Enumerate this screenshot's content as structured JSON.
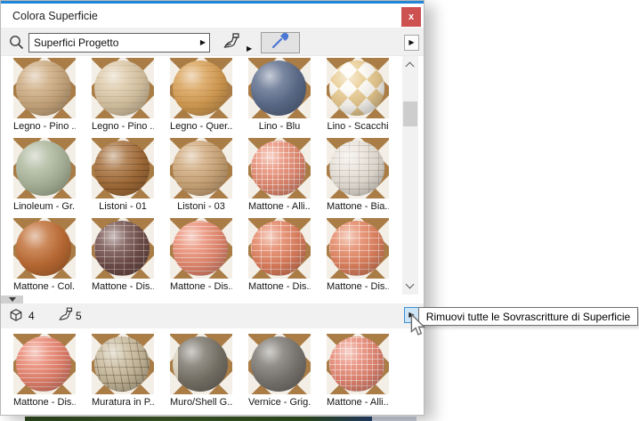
{
  "window": {
    "title": "Colora Superficie",
    "close_glyph": "x"
  },
  "toolbar": {
    "search_value": "Superfici Progetto",
    "dropdown_glyph": "▶",
    "brush_menu_glyph": "▶",
    "panel_arrow_glyph": "▶"
  },
  "status_bar": {
    "surface_count": "4",
    "override_count": "5",
    "menu_glyph": "▶"
  },
  "tooltip": {
    "text": "Rimuovi tutte le Sovrascritture di Superficie"
  },
  "colors": {
    "accent_blue": "#1f86d8",
    "close_red": "#cd5151",
    "checker_brown": "#aa7c46",
    "checker_cream": "#f3efe7",
    "hover_blue_bg": "#cde5f7",
    "hover_blue_border": "#3c8fd4"
  },
  "upper_grid": {
    "items": [
      {
        "label": "Legno - Pino ...",
        "base": "#cdab80",
        "pattern": "planks",
        "line": "rgba(140,100,60,0.22)"
      },
      {
        "label": "Legno - Pino ...",
        "base": "#dcc8a6",
        "pattern": "planks",
        "line": "rgba(150,115,70,0.20)"
      },
      {
        "label": "Legno - Quer...",
        "base": "#d9a055",
        "pattern": "planks",
        "line": "rgba(150,95,30,0.22)"
      },
      {
        "label": "Lino - Blu",
        "base": "#5d6d8c",
        "pattern": "none",
        "line": ""
      },
      {
        "label": "Lino - Scacchi",
        "base": "#e9cb90",
        "pattern": "checker",
        "line": "rgba(255,255,255,0.9)"
      },
      {
        "label": "Linoleum - Gr...",
        "base": "#aeb89d",
        "pattern": "none",
        "line": ""
      },
      {
        "label": "Listoni - 01",
        "base": "#a76f3a",
        "pattern": "planks",
        "line": "rgba(60,35,10,0.35)"
      },
      {
        "label": "Listoni - 03",
        "base": "#d0a97b",
        "pattern": "planks",
        "line": "rgba(120,80,40,0.28)"
      },
      {
        "label": "Mattone - Alli...",
        "base": "#e78a70",
        "pattern": "grid",
        "line": "rgba(255,255,255,0.5)"
      },
      {
        "label": "Mattone - Bia...",
        "base": "#eae4da",
        "pattern": "brick",
        "line": "rgba(180,170,160,0.6)"
      },
      {
        "label": "Mattone - Col...",
        "base": "#c06d34",
        "pattern": "none",
        "line": ""
      },
      {
        "label": "Mattone - Dis...",
        "base": "#6f4d4a",
        "pattern": "brick",
        "line": "rgba(220,200,190,0.5)"
      },
      {
        "label": "Mattone - Dis...",
        "base": "#e98a70",
        "pattern": "lines",
        "line": "rgba(255,255,255,0.45)"
      },
      {
        "label": "Mattone - Dis...",
        "base": "#e2805f",
        "pattern": "brick",
        "line": "rgba(255,240,230,0.55)"
      },
      {
        "label": "Mattone - Dis...",
        "base": "#e38360",
        "pattern": "brick",
        "line": "rgba(255,240,230,0.55)"
      }
    ]
  },
  "lower_grid": {
    "items": [
      {
        "label": "Mattone - Dis...",
        "base": "#e8826c",
        "pattern": "lines",
        "line": "rgba(255,255,255,0.45)"
      },
      {
        "label": "Muratura in P...",
        "base": "#c9bb9d",
        "pattern": "stone",
        "line": "rgba(80,60,35,0.4)"
      },
      {
        "label": "Muro/Shell G...",
        "base": "#797469",
        "pattern": "sliver",
        "line": "#ded6c2"
      },
      {
        "label": "Vernice - Grig...",
        "base": "#7b7771",
        "pattern": "none",
        "line": ""
      },
      {
        "label": "Mattone - Alli...",
        "base": "#e78570",
        "pattern": "grid",
        "line": "rgba(255,255,255,0.5)"
      }
    ]
  }
}
